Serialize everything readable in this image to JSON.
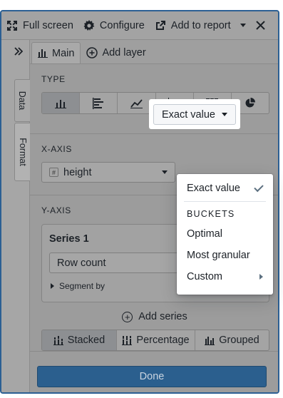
{
  "toolbar": {
    "full_screen": "Full screen",
    "configure": "Configure",
    "add_to_report": "Add to report"
  },
  "rail": {
    "data_tab": "Data",
    "format_tab": "Format"
  },
  "tabs": {
    "main": "Main",
    "add_layer": "Add layer"
  },
  "type_section": {
    "title": "TYPE",
    "options": [
      "vertical-bar-chart-icon",
      "horizontal-bar-chart-icon",
      "line-chart-icon",
      "scatter-plot-icon",
      "heatmap-grid-icon",
      "pie-chart-icon"
    ],
    "selected": "vertical-bar-chart-icon"
  },
  "xaxis": {
    "title": "X-AXIS",
    "field": "height",
    "bucket": "Exact value"
  },
  "yaxis": {
    "title": "Y-AXIS",
    "series_title": "Series 1",
    "aggregation": "Row count",
    "segment_by": "Segment by",
    "add_series": "Add series"
  },
  "stacking": {
    "stacked": "Stacked",
    "percentage": "Percentage",
    "grouped": "Grouped",
    "selected": "Stacked"
  },
  "done_label": "Done",
  "bucket_menu": {
    "exact_value": "Exact value",
    "header": "BUCKETS",
    "optimal": "Optimal",
    "most_granular": "Most granular",
    "custom": "Custom"
  },
  "colors": {
    "accent": "#2b5f8e",
    "overlay_gray": "#9c9c9c"
  }
}
